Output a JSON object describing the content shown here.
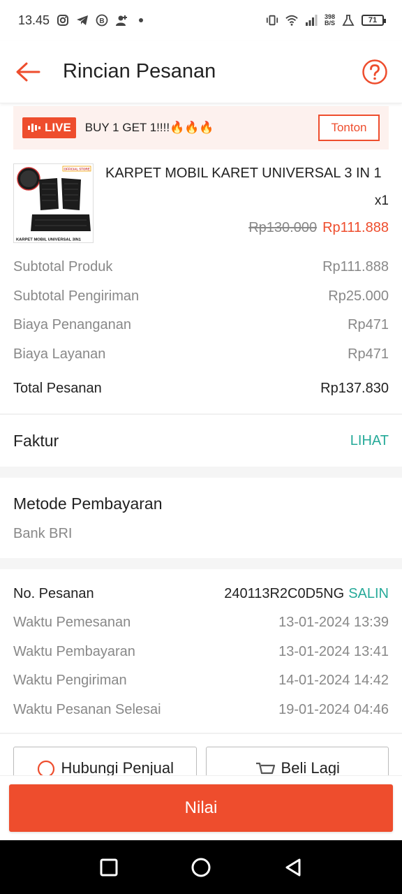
{
  "status_bar": {
    "time": "13.45",
    "net_speed_top": "398",
    "net_speed_bottom": "B/S",
    "battery": "71"
  },
  "header": {
    "title": "Rincian Pesanan"
  },
  "live_banner": {
    "badge": "LIVE",
    "text": "BUY 1 GET 1!!!!🔥🔥🔥",
    "button": "Tonton"
  },
  "product": {
    "name": "KARPET MOBIL KARET UNIVERSAL 3 IN 1",
    "qty": "x1",
    "old_price": "Rp130.000",
    "price": "Rp111.888",
    "img_label_top": "OFFICIAL STORE",
    "img_label_bottom": "KARPET MOBIL UNIVERSAL 3IN1"
  },
  "fees": [
    {
      "label": "Subtotal Produk",
      "value": "Rp111.888"
    },
    {
      "label": "Subtotal Pengiriman",
      "value": "Rp25.000"
    },
    {
      "label": "Biaya Penanganan",
      "value": "Rp471"
    },
    {
      "label": "Biaya Layanan",
      "value": "Rp471"
    }
  ],
  "total": {
    "label": "Total Pesanan",
    "value": "Rp137.830"
  },
  "faktur": {
    "label": "Faktur",
    "link": "LIHAT"
  },
  "payment": {
    "title": "Metode Pembayaran",
    "value": "Bank BRI"
  },
  "order": {
    "no_label": "No. Pesanan",
    "no_value": "240113R2C0D5NG",
    "copy_label": "SALIN",
    "times": [
      {
        "label": "Waktu Pemesanan",
        "value": "13-01-2024 13:39"
      },
      {
        "label": "Waktu Pembayaran",
        "value": "13-01-2024 13:41"
      },
      {
        "label": "Waktu Pengiriman",
        "value": "14-01-2024 14:42"
      },
      {
        "label": "Waktu Pesanan Selesai",
        "value": "19-01-2024 04:46"
      }
    ]
  },
  "actions": {
    "contact_seller": "Hubungi Penjual",
    "buy_again": "Beli Lagi"
  },
  "bottom": {
    "rate_button": "Nilai"
  },
  "colors": {
    "accent": "#ee4d2d",
    "link": "#26aa99",
    "muted": "#888888"
  }
}
